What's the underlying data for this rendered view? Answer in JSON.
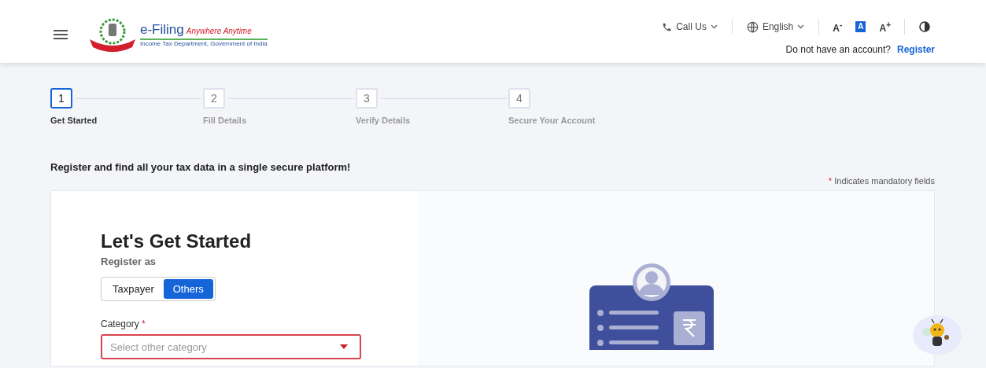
{
  "header": {
    "brand": {
      "title": "e-Filing",
      "tagline": "Anywhere Anytime",
      "subtitle": "Income Tax Department, Government of India"
    },
    "call_us": "Call Us",
    "language": "English",
    "font_controls": [
      {
        "label": "A$^{-}$",
        "selected": false
      },
      {
        "label": "A",
        "selected": true
      },
      {
        "label": "A$^{+}$",
        "selected": false
      }
    ],
    "account_prompt": "Do not have an account?",
    "register_link": "Register"
  },
  "steps": [
    {
      "number": "1",
      "label": "Get Started",
      "selected": true
    },
    {
      "number": "2",
      "label": "Fill Details",
      "selected": false
    },
    {
      "number": "3",
      "label": "Verify Details",
      "selected": false
    },
    {
      "number": "4",
      "label": "Secure Your Account",
      "selected": false
    }
  ],
  "intro": "Register and find all your tax data in a single secure platform!",
  "mandatory_note": {
    "mark": "*",
    "text": "Indicates mandatory fields"
  },
  "form": {
    "title": "Let's Get Started",
    "register_as": "Register as",
    "toggle": [
      {
        "label": "Taxpayer",
        "selected": false
      },
      {
        "label": "Others",
        "selected": true
      }
    ],
    "category": {
      "label": "Category",
      "required": true,
      "placeholder": "Select other category",
      "error": true
    }
  }
}
